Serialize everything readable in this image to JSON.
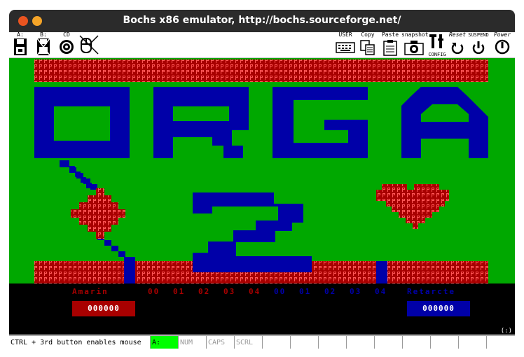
{
  "window": {
    "title": "Bochs x86 emulator, http://bochs.sourceforge.net/"
  },
  "toolbar": {
    "floppy_a": "A:",
    "floppy_b": "B:",
    "cdrom": "CD",
    "user": "USER",
    "copy": "Copy",
    "paste": "Paste",
    "snapshot": "snapshot",
    "config": "CONFIG",
    "reset": "Reset",
    "suspend": "SUSPEND",
    "power": "Power"
  },
  "game": {
    "title_text": "ORGA",
    "title_number": "2",
    "brick_letter": "P",
    "colors": {
      "background": "#00a800",
      "brick": "#a80000",
      "brick_letter": "#ff5555",
      "blue": "#0000a8",
      "red": "#a80000"
    },
    "player1": {
      "name": "Amarin",
      "score": "000000"
    },
    "player2": {
      "name": "Retarcte",
      "score": "000000"
    },
    "slots_red": [
      "00",
      "01",
      "02",
      "03",
      "04"
    ],
    "slots_blue": [
      "00",
      "01",
      "02",
      "03",
      "04"
    ],
    "corner_indicator": "(:)"
  },
  "statusbar": {
    "message": "CTRL + 3rd button enables mouse",
    "drive": "A:",
    "num": "NUM",
    "caps": "CAPS",
    "scrl": "SCRL"
  }
}
